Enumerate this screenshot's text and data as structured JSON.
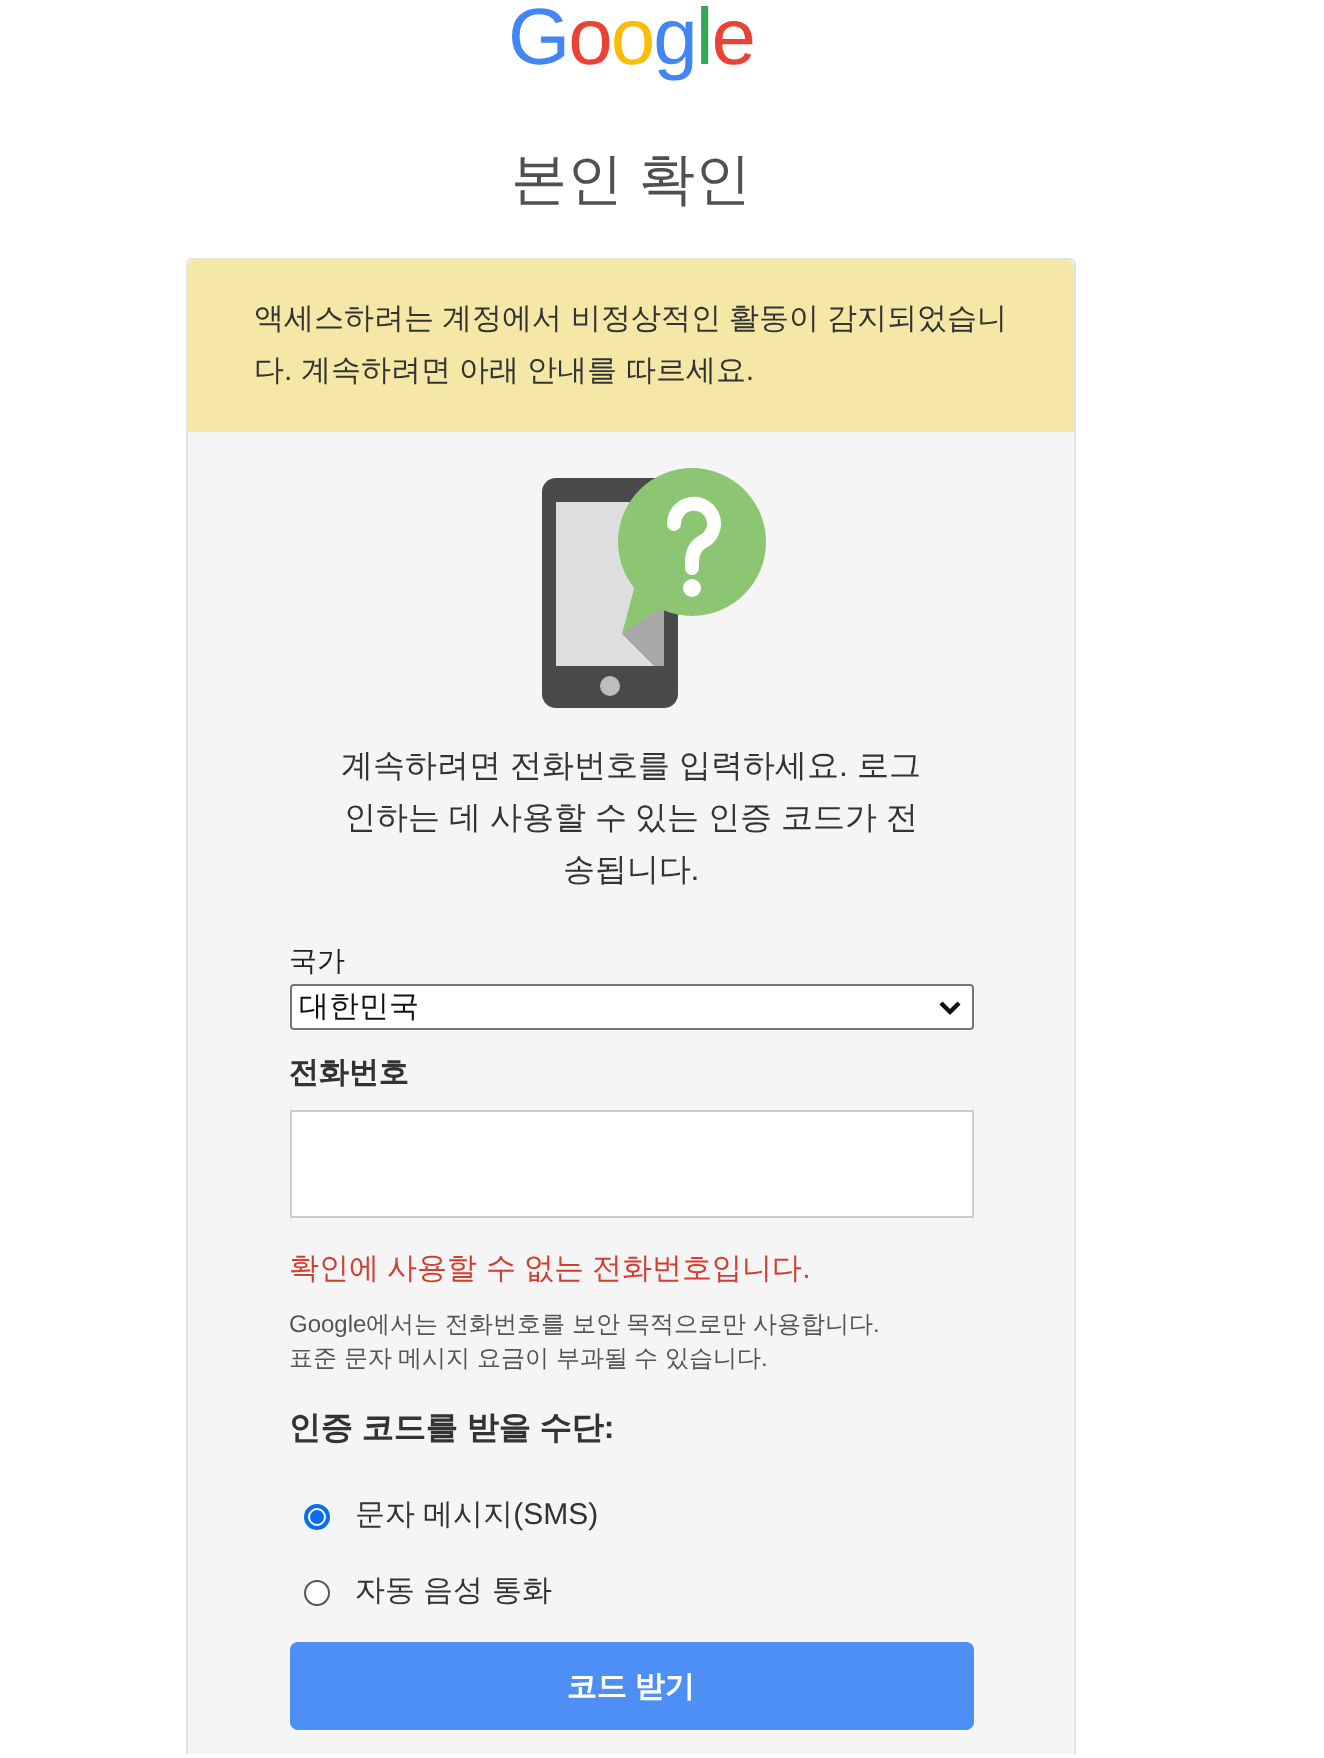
{
  "logo": "Google",
  "title": "본인 확인",
  "alert": {
    "text": "액세스하려는 계정에서 비정상적인 활동이 감지되었습니다. 계속하려면 아래 안내를 따르세요."
  },
  "instruction": "계속하려면 전화번호를 입력하세요. 로그인하는 데 사용할 수 있는 인증 코드가 전송됩니다.",
  "country": {
    "label": "국가",
    "value": "대한민국"
  },
  "phone": {
    "label": "전화번호",
    "error": "확인에 사용할 수 없는 전화번호입니다."
  },
  "note_lines": [
    "Google에서는 전화번호를 보안 목적으로만 사용합니다.",
    "표준 문자 메시지 요금이 부과될 수 있습니다."
  ],
  "method": {
    "heading": "인증 코드를 받을 수단:",
    "options": [
      {
        "label": "문자 메시지(SMS)",
        "selected": true
      },
      {
        "label": "자동 음성 통화",
        "selected": false
      }
    ]
  },
  "submit_button": "코드 받기"
}
